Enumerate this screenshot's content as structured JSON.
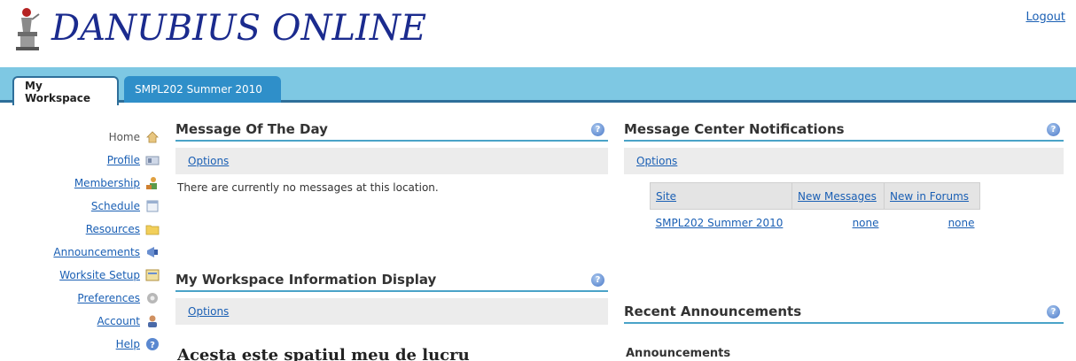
{
  "header": {
    "title": "DANUBIUS ONLINE",
    "logout_label": "Logout"
  },
  "tabs": [
    {
      "label": "My Workspace",
      "active": true
    },
    {
      "label": "SMPL202 Summer 2010",
      "active": false
    }
  ],
  "leftnav": {
    "items": [
      {
        "label": "Home",
        "icon": "home-icon",
        "current": true
      },
      {
        "label": "Profile",
        "icon": "profile-icon"
      },
      {
        "label": "Membership",
        "icon": "membership-icon"
      },
      {
        "label": "Schedule",
        "icon": "calendar-icon"
      },
      {
        "label": "Resources",
        "icon": "folder-icon"
      },
      {
        "label": "Announcements",
        "icon": "megaphone-icon"
      },
      {
        "label": "Worksite Setup",
        "icon": "worksite-icon"
      },
      {
        "label": "Preferences",
        "icon": "gear-icon"
      },
      {
        "label": "Account",
        "icon": "person-icon"
      },
      {
        "label": "Help",
        "icon": "help-icon"
      }
    ]
  },
  "motd": {
    "title": "Message Of The Day",
    "options_label": "Options",
    "body": "There are currently no messages at this location."
  },
  "workspace_info": {
    "title": "My Workspace Information Display",
    "options_label": "Options",
    "body": "Acesta este spatiul meu de lucru"
  },
  "notifications": {
    "title": "Message Center Notifications",
    "options_label": "Options",
    "headers": [
      "Site",
      "New Messages",
      "New in Forums"
    ],
    "rows": [
      {
        "site": "SMPL202 Summer 2010",
        "new_messages": "none",
        "new_forums": "none"
      }
    ]
  },
  "announcements": {
    "title": "Recent Announcements",
    "body": "Announcements"
  },
  "colors": {
    "brand": "#1b2b8e",
    "tabbar": "#7ec8e3",
    "link": "#1a5fb4",
    "accent_line": "#4aa3c8"
  }
}
